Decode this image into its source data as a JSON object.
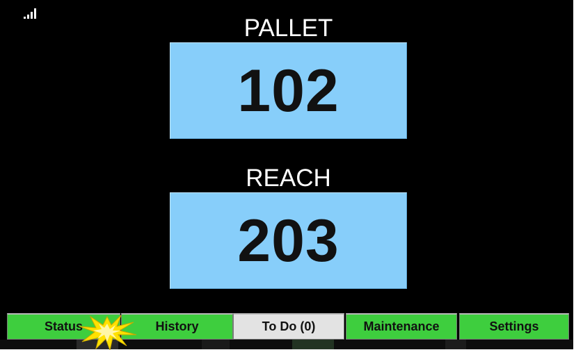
{
  "signal": {
    "icon": "signal-strength-icon",
    "bars": 4
  },
  "pallet": {
    "label": "PALLET",
    "value": "102"
  },
  "reach": {
    "label": "REACH",
    "value": "203"
  },
  "tabs": [
    {
      "label": "Status",
      "state": "green"
    },
    {
      "label": "History",
      "state": "green"
    },
    {
      "label": "To Do (0)",
      "state": "active"
    },
    {
      "label": "Maintenance",
      "state": "green"
    },
    {
      "label": "Settings",
      "state": "green"
    }
  ],
  "colors": {
    "background": "#000000",
    "value_box": "#87cefa",
    "tab_green": "#3ece3e",
    "tab_active": "#e3e3e3",
    "click_burst": "#ffe100"
  }
}
